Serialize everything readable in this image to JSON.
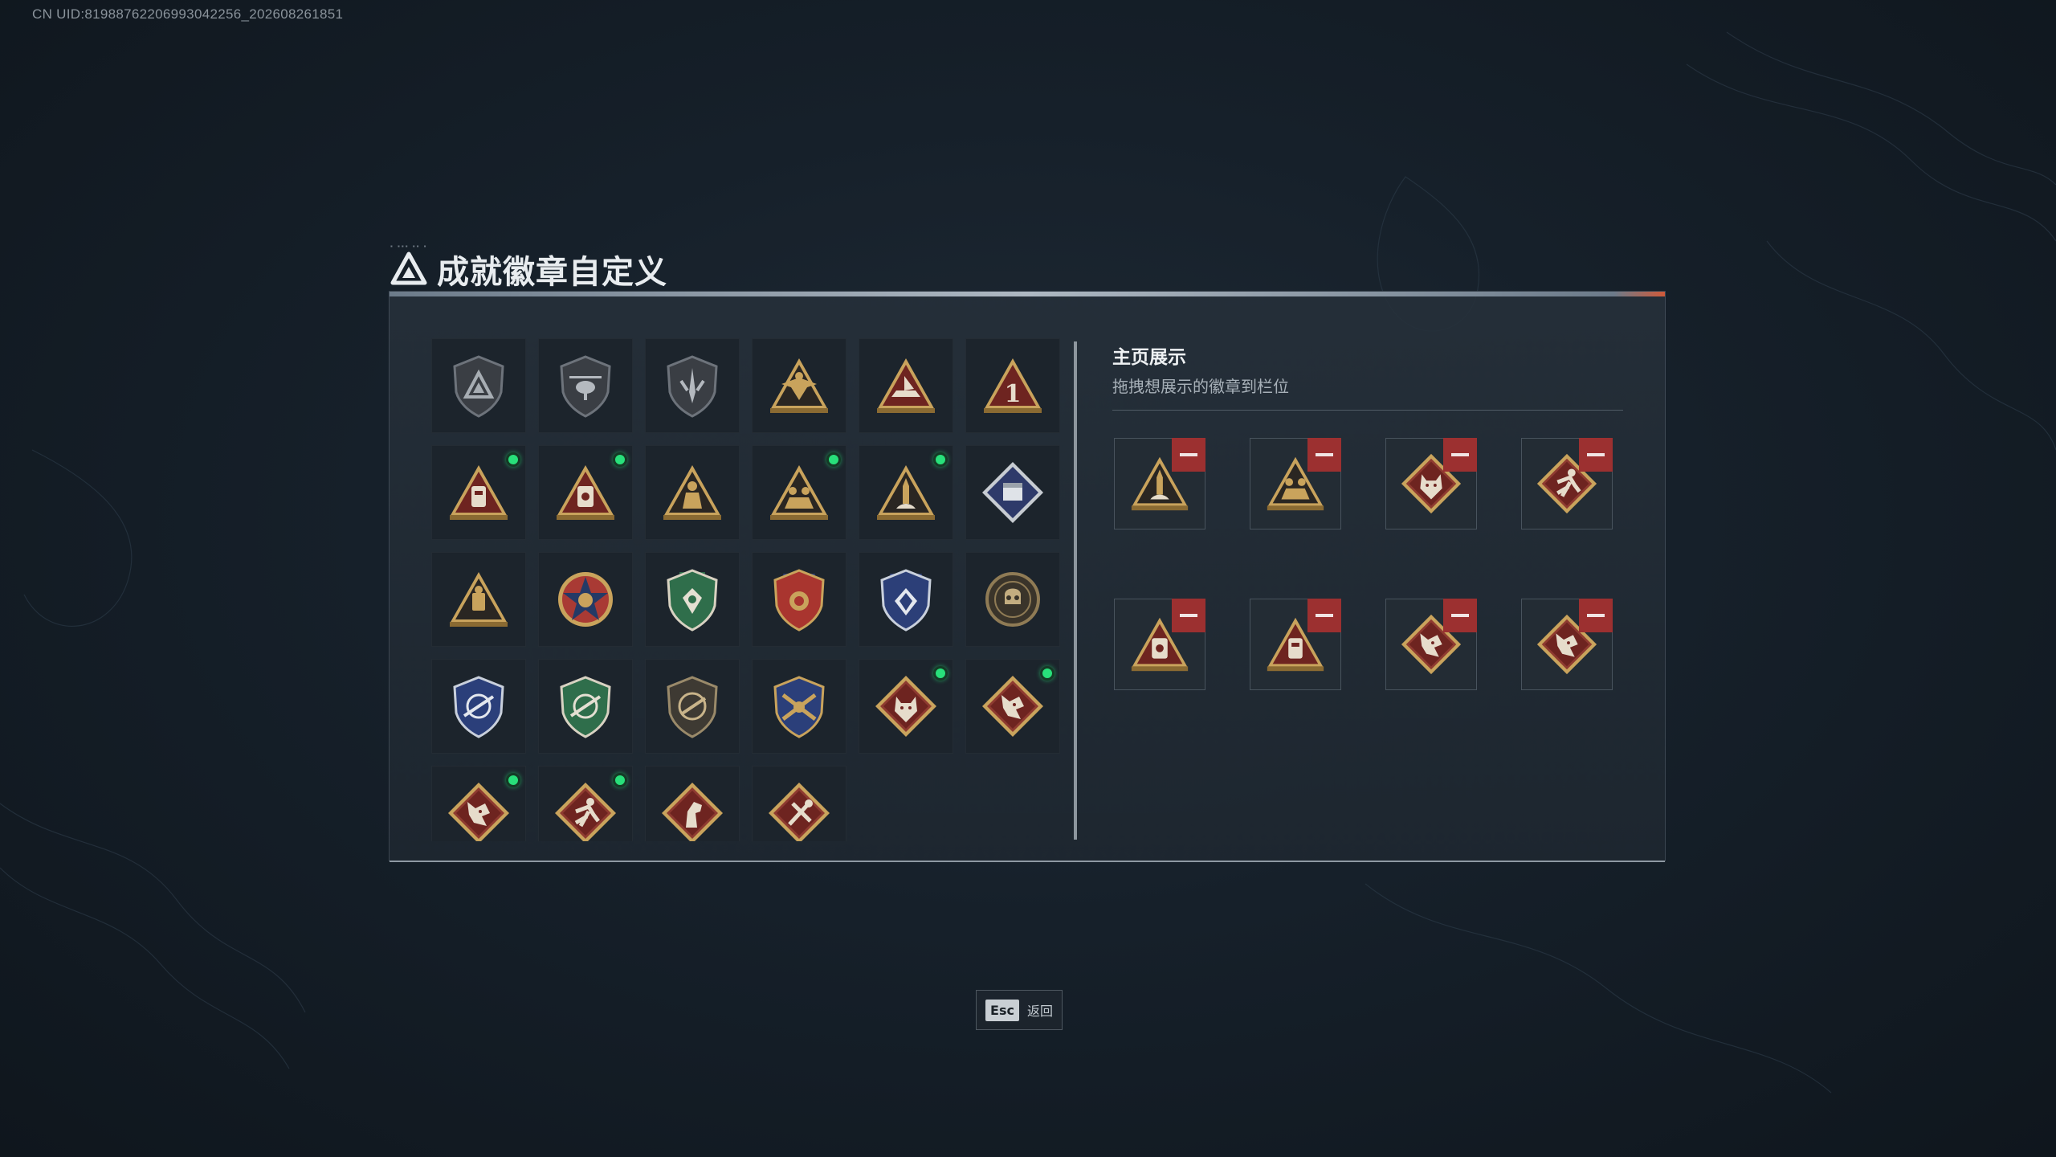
{
  "uid_text": "CN UID:8198876220699304225​6_202608261851",
  "header": {
    "title": "成就徽章自定义"
  },
  "badge_grid": {
    "cells": [
      {
        "icon": "triangle-shield-icon",
        "new": false
      },
      {
        "icon": "helicopter-shield-icon",
        "new": false
      },
      {
        "icon": "sword-shield-icon",
        "new": false
      },
      {
        "icon": "eagle-triangle-icon",
        "new": false
      },
      {
        "icon": "boat-triangle-icon",
        "new": false
      },
      {
        "icon": "number-one-triangle-icon",
        "new": false
      },
      {
        "icon": "vest-triangle-icon",
        "new": true
      },
      {
        "icon": "medkit-triangle-icon",
        "new": true
      },
      {
        "icon": "soldier-triangle-icon",
        "new": false
      },
      {
        "icon": "squad-triangle-icon",
        "new": true
      },
      {
        "icon": "missile-triangle-icon",
        "new": true
      },
      {
        "icon": "crate-diamond-icon",
        "new": false
      },
      {
        "icon": "gear-triangle-icon",
        "new": false
      },
      {
        "icon": "star-medal-icon",
        "new": false
      },
      {
        "icon": "green-crest-icon",
        "new": false
      },
      {
        "icon": "red-star-crest-icon",
        "new": false
      },
      {
        "icon": "blue-crest-icon",
        "new": false
      },
      {
        "icon": "skull-coin-icon",
        "new": false
      },
      {
        "icon": "blue-crosshair-crest-icon",
        "new": false
      },
      {
        "icon": "green-crosshair-crest-icon",
        "new": false
      },
      {
        "icon": "rifle-shield-icon",
        "new": false
      },
      {
        "icon": "gold-crossed-rifles-icon",
        "new": false
      },
      {
        "icon": "wolf-diamond-icon",
        "new": true
      },
      {
        "icon": "dragon-diamond-icon",
        "new": true
      },
      {
        "icon": "dragon-diamond-icon",
        "new": true
      },
      {
        "icon": "runner-diamond-icon",
        "new": true
      },
      {
        "icon": "horse-diamond-icon",
        "new": false
      },
      {
        "icon": "tools-diamond-icon",
        "new": false
      }
    ]
  },
  "showcase": {
    "title": "主页展示",
    "subtitle": "拖拽想展示的徽章到栏位",
    "slots": [
      {
        "icon": "missile-triangle-icon"
      },
      {
        "icon": "squad-triangle-icon"
      },
      {
        "icon": "wolf-diamond-icon"
      },
      {
        "icon": "runner-diamond-icon"
      },
      {
        "icon": "medkit-triangle-icon"
      },
      {
        "icon": "vest-triangle-icon"
      },
      {
        "icon": "dragon-diamond-icon"
      },
      {
        "icon": "dragon-diamond-icon"
      }
    ]
  },
  "footer": {
    "esc_key": "Esc",
    "esc_label": "返回"
  },
  "colors": {
    "new_dot": "#28e07a",
    "remove": "#9c3030",
    "gold": "#c9a35c",
    "red_badge": "#7a2a24"
  }
}
